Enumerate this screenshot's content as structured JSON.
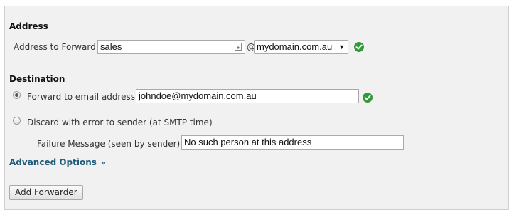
{
  "address_section": {
    "heading": "Address",
    "forward_label": "Address to Forward:",
    "forward_value": "sales",
    "at_sign": "@",
    "domain_selected": "mydomain.com.au"
  },
  "destination_section": {
    "heading": "Destination",
    "forward_email_label": "Forward to email address:",
    "forward_email_value": "johndoe@mydomain.com.au",
    "discard_label": "Discard with error to sender (at SMTP time)",
    "failure_label": "Failure Message (seen by sender):",
    "failure_value": "No such person at this address",
    "selected_option": "forward"
  },
  "advanced": {
    "label": "Advanced Options",
    "chevron": "»"
  },
  "submit": {
    "label": "Add Forwarder"
  },
  "colors": {
    "valid_check": "#2f9a37",
    "advanced_link": "#1d5a78"
  },
  "icons": [
    "contact-card-icon",
    "valid-check-icon",
    "dropdown-caret-icon",
    "double-chevron-icon"
  ]
}
